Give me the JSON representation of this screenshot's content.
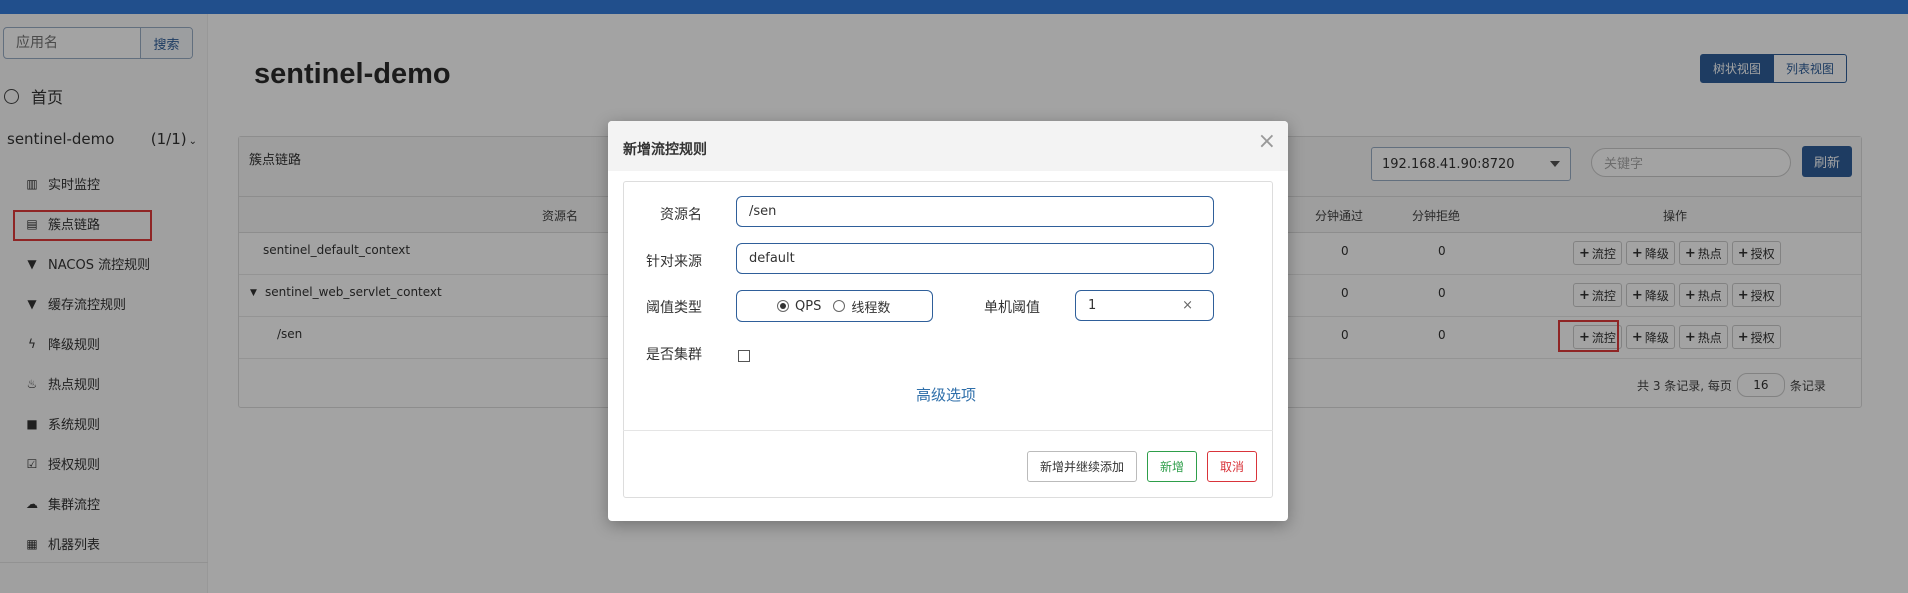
{
  "sidebar": {
    "search_placeholder": "应用名",
    "search_button": "搜索",
    "home": "首页",
    "app_name": "sentinel-demo",
    "app_count": "(1/1)",
    "menu": [
      {
        "label": "实时监控",
        "icon": "bar-chart-icon",
        "glyph": "▥"
      },
      {
        "label": "簇点链路",
        "icon": "list-icon",
        "glyph": "▤"
      },
      {
        "label": "NACOS 流控规则",
        "icon": "filter-icon",
        "glyph": "▼"
      },
      {
        "label": "缓存流控规则",
        "icon": "filter-icon",
        "glyph": "▼"
      },
      {
        "label": "降级规则",
        "icon": "flash-icon",
        "glyph": "ϟ"
      },
      {
        "label": "热点规则",
        "icon": "fire-icon",
        "glyph": "♨"
      },
      {
        "label": "系统规则",
        "icon": "lock-icon",
        "glyph": "■"
      },
      {
        "label": "授权规则",
        "icon": "check-icon",
        "glyph": "☑"
      },
      {
        "label": "集群流控",
        "icon": "cloud-icon",
        "glyph": "☁"
      },
      {
        "label": "机器列表",
        "icon": "grid-icon",
        "glyph": "▦"
      }
    ]
  },
  "main": {
    "title": "sentinel-demo",
    "view_tree": "树状视图",
    "view_list": "列表视图",
    "panel_title": "簇点链路",
    "machine": "192.168.41.90:8720",
    "keyword_placeholder": "关键字",
    "refresh": "刷新",
    "columns": {
      "resource": "资源名",
      "pass": "分钟通过",
      "block": "分钟拒绝",
      "ops": "操作"
    },
    "rows": [
      {
        "name": "sentinel_default_context",
        "pass": "0",
        "block": "0"
      },
      {
        "name": "sentinel_web_servlet_context",
        "pass": "0",
        "block": "0"
      },
      {
        "name": "/sen",
        "pass": "0",
        "block": "0"
      }
    ],
    "ops": [
      "流控",
      "降级",
      "热点",
      "授权"
    ],
    "pager_prefix": "共 3 条记录, 每页",
    "page_size": "16",
    "pager_suffix": "条记录"
  },
  "modal": {
    "title": "新增流控规则",
    "close": "×",
    "resource_label": "资源名",
    "resource_value": "/sen",
    "origin_label": "针对来源",
    "origin_value": "default",
    "threshold_type_label": "阈值类型",
    "qps": "QPS",
    "threads": "线程数",
    "threshold_label": "单机阈值",
    "threshold_value": "1",
    "clear": "×",
    "cluster_label": "是否集群",
    "advanced": "高级选项",
    "btn_add_continue": "新增并继续添加",
    "btn_add": "新增",
    "btn_cancel": "取消"
  },
  "colors": {
    "primary": "#2f5f9a",
    "success": "#2e9e4a",
    "danger": "#d9343a",
    "highlight": "#e03a3a"
  }
}
